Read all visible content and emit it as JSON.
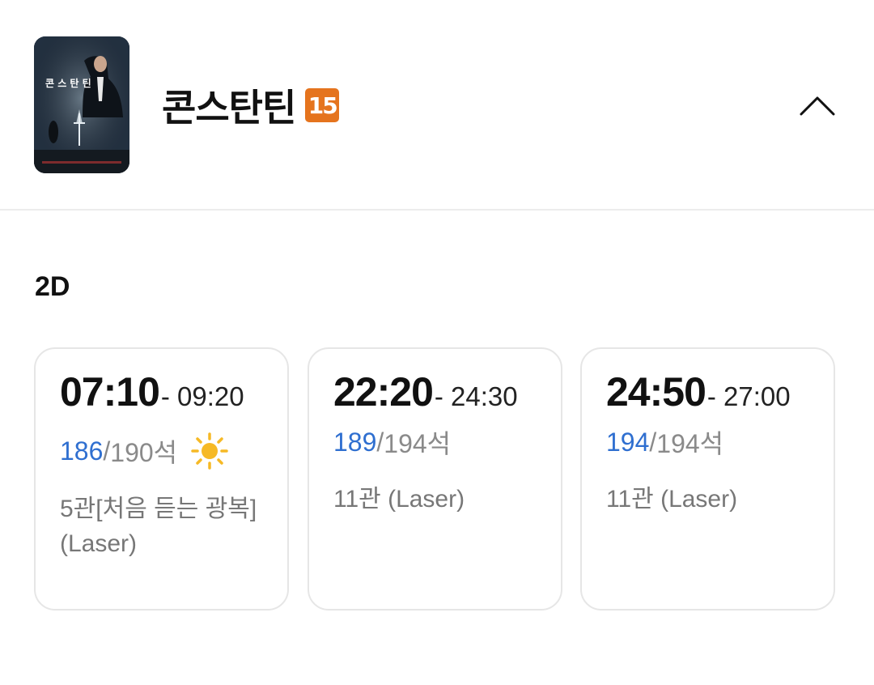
{
  "movie": {
    "title": "콘스탄틴",
    "age_rating": "15",
    "poster_title": "콘 스 탄 틴"
  },
  "format": "2D",
  "showtimes": [
    {
      "start": "07:10",
      "end": "- 09:20",
      "available": "186",
      "slash": "/",
      "total": "190석",
      "morning_icon": "sun-icon",
      "hall": "5관[처음 듣는 광복](Laser)"
    },
    {
      "start": "22:20",
      "end": "- 24:30",
      "available": "189",
      "slash": "/",
      "total": "194석",
      "hall": "11관 (Laser)"
    },
    {
      "start": "24:50",
      "end": "- 27:00",
      "available": "194",
      "slash": "/",
      "total": "194석",
      "hall": "11관 (Laser)"
    }
  ],
  "colors": {
    "age_badge": "#e5741e",
    "available_seats": "#2f6fd0",
    "sun": "#f6b925"
  },
  "icons": {
    "collapse": "chevron-up-icon"
  }
}
